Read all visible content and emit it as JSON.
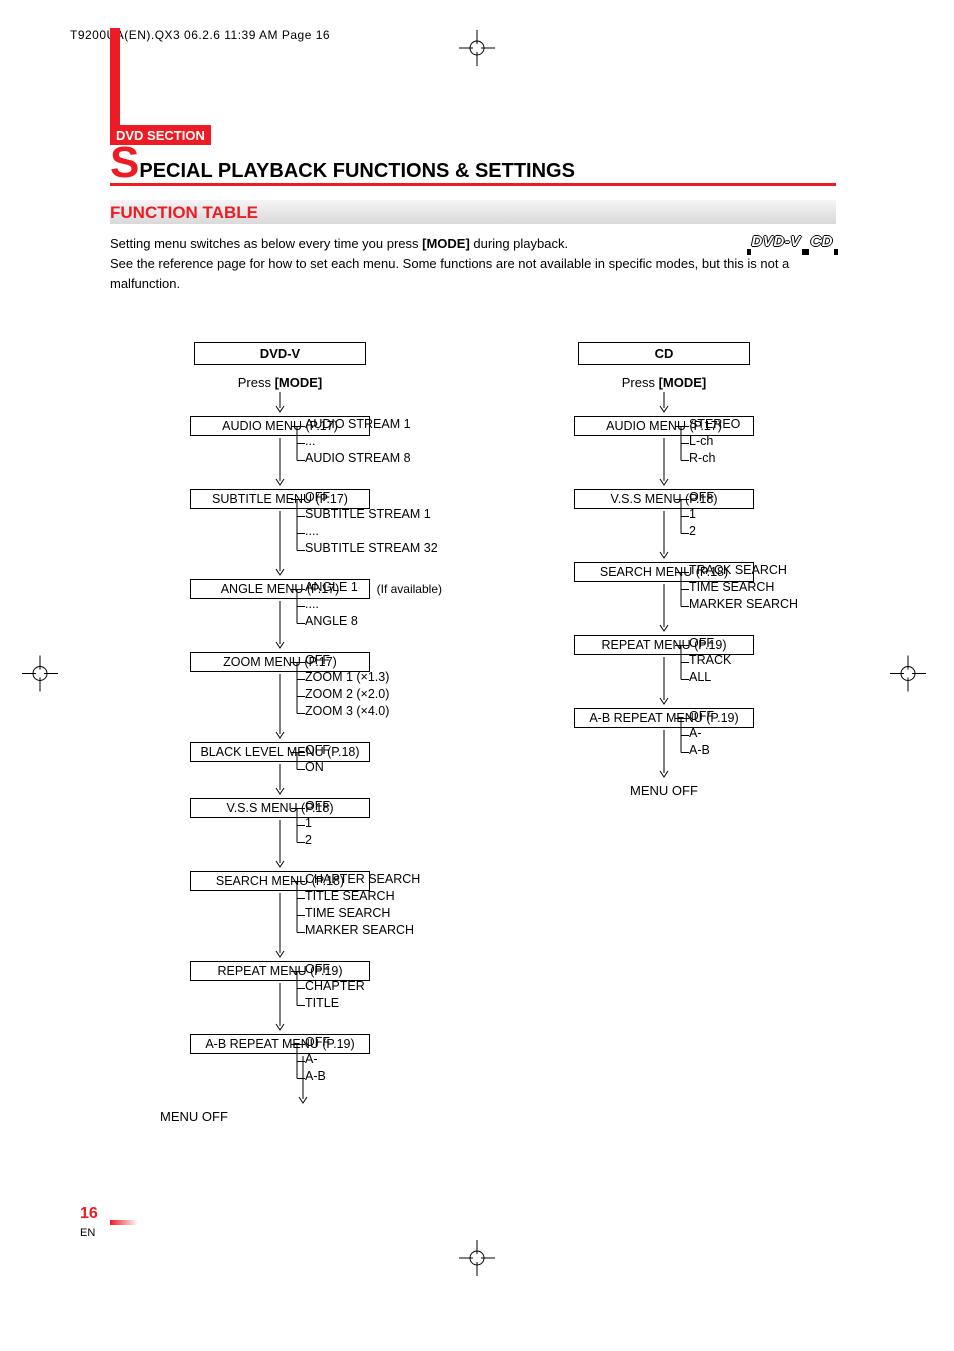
{
  "print_header": "T9200UA(EN).QX3  06.2.6  11:39 AM  Page 16",
  "section_tag": "DVD SECTION",
  "title_first_letter": "S",
  "title_rest": "PECIAL PLAYBACK FUNCTIONS & SETTINGS",
  "subtitle": "FUNCTION TABLE",
  "body_line1_a": "Setting menu switches as below every time you press ",
  "body_line1_mode": "[MODE]",
  "body_line1_b": " during playback.",
  "body_line2": "See the reference page for how to set each menu. Some functions are not available in specific modes, but this is not a malfunction.",
  "badge_dvdv": "DVD-V",
  "badge_cd": "CD",
  "press_label_a": "Press ",
  "press_label_mode": "[MODE]",
  "menu_off": "MENU OFF",
  "dvdv": {
    "header": "DVD-V",
    "items": [
      {
        "label": "AUDIO MENU (P.17)",
        "opts": [
          "AUDIO STREAM 1",
          "...",
          "AUDIO STREAM 8"
        ]
      },
      {
        "label": "SUBTITLE MENU (P.17)",
        "opts": [
          "OFF",
          "SUBTITLE STREAM 1",
          "....",
          "SUBTITLE STREAM 32"
        ]
      },
      {
        "label": "ANGLE MENU (P.17)",
        "note": "(If available)",
        "opts": [
          "ANGLE 1",
          "....",
          "ANGLE 8"
        ]
      },
      {
        "label": "ZOOM MENU (P.17)",
        "opts": [
          "OFF",
          "ZOOM 1 (×1.3)",
          "ZOOM 2 (×2.0)",
          "ZOOM 3 (×4.0)"
        ]
      },
      {
        "label": "BLACK LEVEL MENU (P.18)",
        "opts": [
          "OFF",
          "ON"
        ]
      },
      {
        "label": "V.S.S MENU (P.18)",
        "opts": [
          "OFF",
          "1",
          "2"
        ]
      },
      {
        "label": "SEARCH MENU (P.18)",
        "opts": [
          "CHAPTER SEARCH",
          "TITLE SEARCH",
          "TIME SEARCH",
          "MARKER SEARCH"
        ]
      },
      {
        "label": "REPEAT MENU (P.19)",
        "opts": [
          "OFF",
          "CHAPTER",
          "TITLE"
        ]
      },
      {
        "label": "A-B REPEAT MENU (P.19)",
        "opts": [
          "OFF",
          "A-",
          "A-B"
        ]
      }
    ]
  },
  "cd": {
    "header": "CD",
    "items": [
      {
        "label": "AUDIO MENU (P.17)",
        "opts": [
          "STEREO",
          "L-ch",
          "R-ch"
        ]
      },
      {
        "label": "V.S.S  MENU (P.18)",
        "opts": [
          "OFF",
          "1",
          "2"
        ]
      },
      {
        "label": "SEARCH MENU (P.18)",
        "opts": [
          "TRACK SEARCH",
          "TIME SEARCH",
          "MARKER SEARCH"
        ]
      },
      {
        "label": "REPEAT MENU (P.19)",
        "opts": [
          "OFF",
          "TRACK",
          "ALL"
        ]
      },
      {
        "label": "A-B REPEAT MENU (P.19)",
        "opts": [
          "OFF",
          "A-",
          "A-B"
        ]
      }
    ]
  },
  "page_number": "16",
  "page_lang": "EN"
}
